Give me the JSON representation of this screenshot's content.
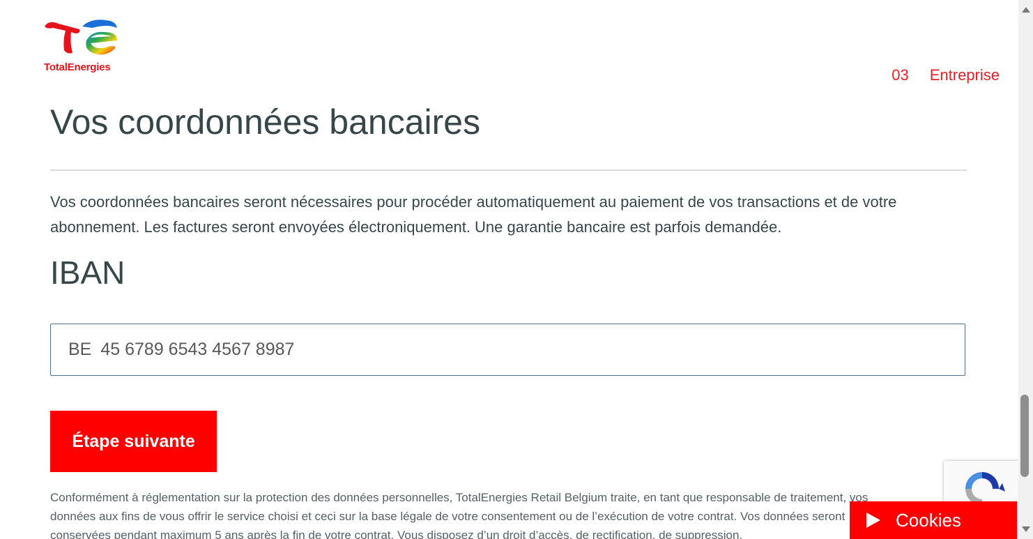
{
  "brand": {
    "name": "TotalEnergies",
    "logo_icon": "totalenergies-logo-icon",
    "color": "#ee1d23"
  },
  "nav": {
    "step_number": "03",
    "step_label": "Entreprise"
  },
  "page": {
    "title": "Vos coordonnées bancaires",
    "intro": "Vos coordonnées bancaires seront nécessaires pour procéder automatiquement au paiement de vos transactions et de votre abonnement. Les factures seront envoyées électroniquement. Une garantie bancaire est parfois demandée."
  },
  "iban": {
    "heading": "IBAN",
    "prefix": "BE",
    "value": "45 6789 6543 4567 8987"
  },
  "actions": {
    "next_label": "Étape suivante"
  },
  "legal": {
    "text": "Conformément à réglementation sur la protection des données personnelles, TotalEnergies Retail Belgium traite, en tant que responsable de traitement, vos données aux fins de vous offrir le service choisi et ceci sur la base légale de votre consentement ou de l’exécution de votre contrat. Vos données seront conservées pendant maximum 5 ans après la fin de votre contrat. Vous disposez d’un droit d’accès, de rectification, de suppression,"
  },
  "cookies": {
    "label": "Cookies",
    "icon": "play-icon"
  },
  "recaptcha": {
    "icon": "recaptcha-icon"
  }
}
